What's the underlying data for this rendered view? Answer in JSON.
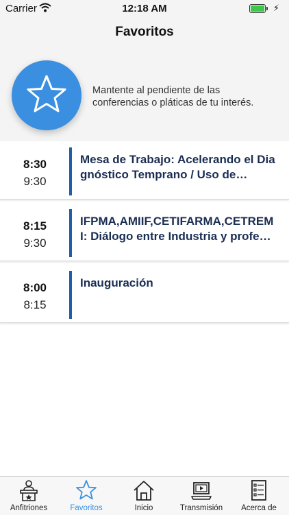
{
  "status_bar": {
    "carrier": "Carrier",
    "time": "12:18 AM"
  },
  "header": {
    "title": "Favoritos"
  },
  "hero": {
    "description": "Mantente al pendiente de las conferencias o pláticas de tu interés."
  },
  "events": [
    {
      "start": "8:30",
      "end": "9:30",
      "title": "Mesa de Trabajo: Acelerando el Diagnóstico Temprano / Uso de…"
    },
    {
      "start": "8:15",
      "end": "9:30",
      "title": "IFPMA,AMIIF,CETIFARMA,CETREMI:  Diálogo entre Industria y profe…"
    },
    {
      "start": "8:00",
      "end": "8:15",
      "title": "Inauguración"
    }
  ],
  "tabs": [
    {
      "label": "Anfitriones",
      "icon": "host-podium-icon",
      "active": false
    },
    {
      "label": "Favoritos",
      "icon": "star-icon",
      "active": true
    },
    {
      "label": "Inicio",
      "icon": "home-icon",
      "active": false
    },
    {
      "label": "Transmisión",
      "icon": "laptop-play-icon",
      "active": false
    },
    {
      "label": "Acerca de",
      "icon": "document-list-icon",
      "active": false
    }
  ],
  "colors": {
    "accent": "#3b8fe0",
    "event_bar": "#1f5fa6",
    "event_title": "#1a2d52",
    "battery": "#3cc84a"
  }
}
